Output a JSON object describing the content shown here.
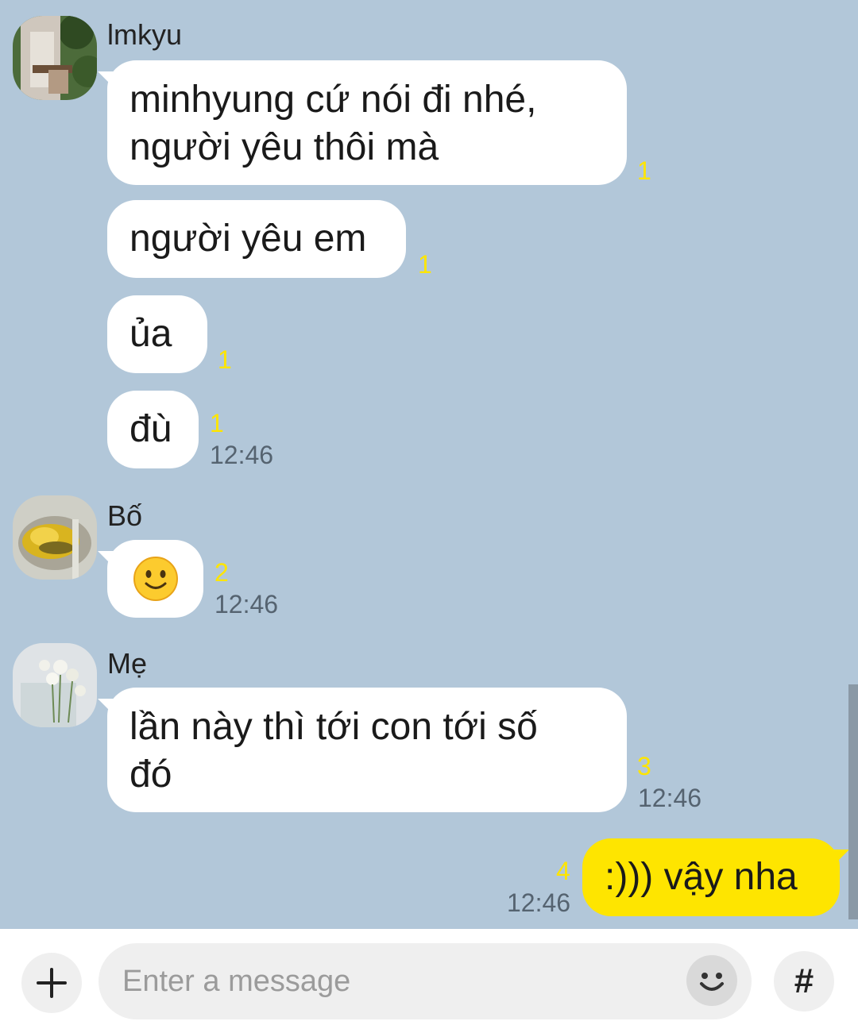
{
  "chat": {
    "groups": [
      {
        "sender": "lmkyu",
        "messages": [
          {
            "lines": [
              "minhyung cứ nói đi nhé,",
              "người yêu thôi mà"
            ],
            "unread": "1"
          },
          {
            "lines": [
              "người yêu em"
            ],
            "unread": "1"
          },
          {
            "lines": [
              "ủa"
            ],
            "unread": "1"
          },
          {
            "lines": [
              "đù"
            ],
            "unread": "1",
            "time": "12:46"
          }
        ]
      },
      {
        "sender": "Bố",
        "messages": [
          {
            "emoji": "🙂",
            "unread": "2",
            "time": "12:46"
          }
        ]
      },
      {
        "sender": "Mẹ",
        "messages": [
          {
            "lines": [
              "lần này thì tới con tới số",
              "đó"
            ],
            "unread": "3",
            "time": "12:46"
          }
        ]
      }
    ],
    "my_message": {
      "text": ":))) vậy nha",
      "unread": "4",
      "time": "12:46"
    }
  },
  "input_bar": {
    "placeholder": "Enter a message",
    "add_icon": "plus-icon",
    "emoji_icon": "smiley-icon",
    "hashtag_icon": "hash-icon",
    "hashtag_label": "#"
  },
  "colors": {
    "background": "#b2c7d9",
    "my_bubble": "#fee500",
    "other_bubble": "#ffffff",
    "unread_count": "#fee500"
  }
}
